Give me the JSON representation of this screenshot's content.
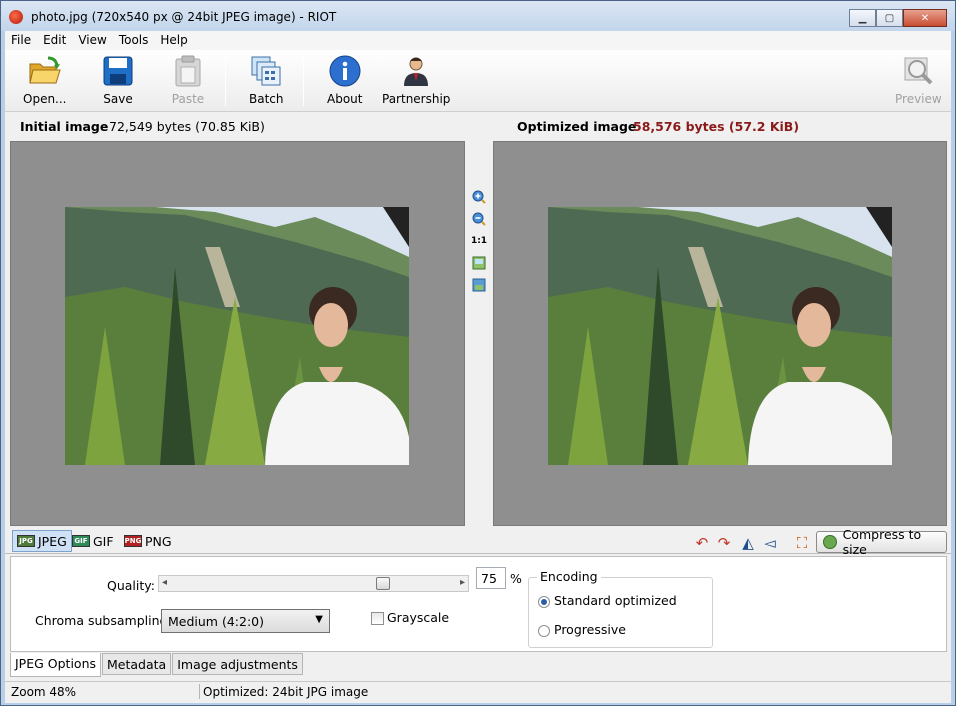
{
  "window": {
    "title": "photo.jpg (720x540 px @ 24bit JPEG image) - RIOT",
    "controls": {
      "minimize": "▁",
      "maximize": "▢",
      "close": "✕"
    }
  },
  "menu": [
    "File",
    "Edit",
    "View",
    "Tools",
    "Help"
  ],
  "toolbar": {
    "open_label": "Open...",
    "save_label": "Save",
    "paste_label": "Paste",
    "batch_label": "Batch",
    "about_label": "About",
    "partnership_label": "Partnership",
    "preview_label": "Preview"
  },
  "info": {
    "initial_label": "Initial image",
    "initial_size": "72,549 bytes (70.85 KiB)",
    "optimized_label": "Optimized image",
    "optimized_size": "58,576 bytes (57.2 KiB)"
  },
  "center_tools": {
    "zoom_in": "zoom-in-icon",
    "zoom_out": "zoom-out-icon",
    "actual_size": "1:1",
    "fit": "fit-image-icon",
    "compare": "compare-icon"
  },
  "format_tabs": [
    "JPEG",
    "GIF",
    "PNG"
  ],
  "format_badges": [
    "JPG",
    "GIF",
    "PNG"
  ],
  "tools": {
    "compress_label": "Compress to size",
    "rotate_ccw": "↶",
    "rotate_cw": "↷",
    "flip_h": "◭",
    "flip_v": "◅",
    "resize": "⛶"
  },
  "options": {
    "quality_label": "Quality:",
    "quality_value": "75",
    "quality_fraction": 0.75,
    "quality_unit": "%",
    "slider_left": "◂",
    "slider_right": "▸",
    "chroma_label": "Chroma subsampling:",
    "chroma_value": "Medium (4:2:0)",
    "grayscale_label": "Grayscale",
    "encoding_legend": "Encoding",
    "standard_label": "Standard optimized",
    "progressive_label": "Progressive"
  },
  "bottom_tabs": [
    "JPEG Options",
    "Metadata",
    "Image adjustments"
  ],
  "status": {
    "zoom": "Zoom 48%",
    "message": "Optimized: 24bit JPG image"
  },
  "colors": {
    "accent": "#2a5ea8",
    "optimized_size": "#8b1a1a",
    "pane_background": "#8f8f8f"
  }
}
